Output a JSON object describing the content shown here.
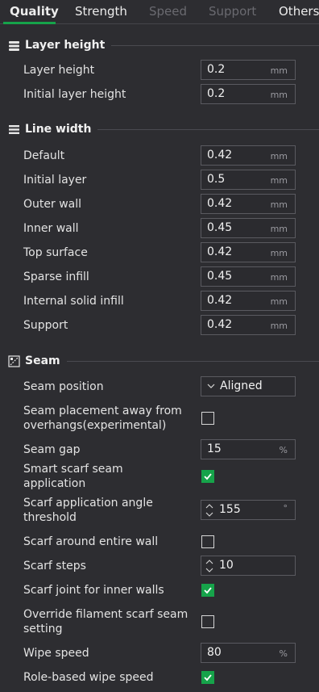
{
  "tabs": [
    "Quality",
    "Strength",
    "Speed",
    "Support",
    "Others"
  ],
  "sections": {
    "layer_height": {
      "title": "Layer height",
      "rows": [
        {
          "label": "Layer height",
          "value": "0.2",
          "unit": "mm"
        },
        {
          "label": "Initial layer height",
          "value": "0.2",
          "unit": "mm"
        }
      ]
    },
    "line_width": {
      "title": "Line width",
      "rows": [
        {
          "label": "Default",
          "value": "0.42",
          "unit": "mm"
        },
        {
          "label": "Initial layer",
          "value": "0.5",
          "unit": "mm"
        },
        {
          "label": "Outer wall",
          "value": "0.42",
          "unit": "mm"
        },
        {
          "label": "Inner wall",
          "value": "0.45",
          "unit": "mm"
        },
        {
          "label": "Top surface",
          "value": "0.42",
          "unit": "mm"
        },
        {
          "label": "Sparse infill",
          "value": "0.45",
          "unit": "mm"
        },
        {
          "label": "Internal solid infill",
          "value": "0.42",
          "unit": "mm"
        },
        {
          "label": "Support",
          "value": "0.42",
          "unit": "mm"
        }
      ]
    },
    "seam": {
      "title": "Seam",
      "seam_position": {
        "label": "Seam position",
        "value": "Aligned"
      },
      "seam_away": {
        "label_line1": "Seam placement away from",
        "label_line2": "overhangs(experimental)",
        "checked": false
      },
      "seam_gap": {
        "label": "Seam gap",
        "value": "15",
        "unit": "%"
      },
      "smart_scarf": {
        "label_line1": "Smart scarf seam",
        "label_line2": "application",
        "checked": true
      },
      "scarf_angle": {
        "label_line1": "Scarf application angle",
        "label_line2": "threshold",
        "value": "155",
        "unit": "°"
      },
      "scarf_entire": {
        "label": "Scarf around entire wall",
        "checked": false
      },
      "scarf_steps": {
        "label": "Scarf steps",
        "value": "10"
      },
      "scarf_inner": {
        "label": "Scarf joint for inner walls",
        "checked": true
      },
      "override_filament": {
        "label_line1": "Override filament scarf seam",
        "label_line2": "setting",
        "checked": false
      },
      "wipe_speed": {
        "label": "Wipe speed",
        "value": "80",
        "unit": "%"
      },
      "role_wipe": {
        "label": "Role-based wipe speed",
        "checked": true
      }
    }
  },
  "colors": {
    "accent": "#16a34a",
    "background": "#2d2d31"
  }
}
